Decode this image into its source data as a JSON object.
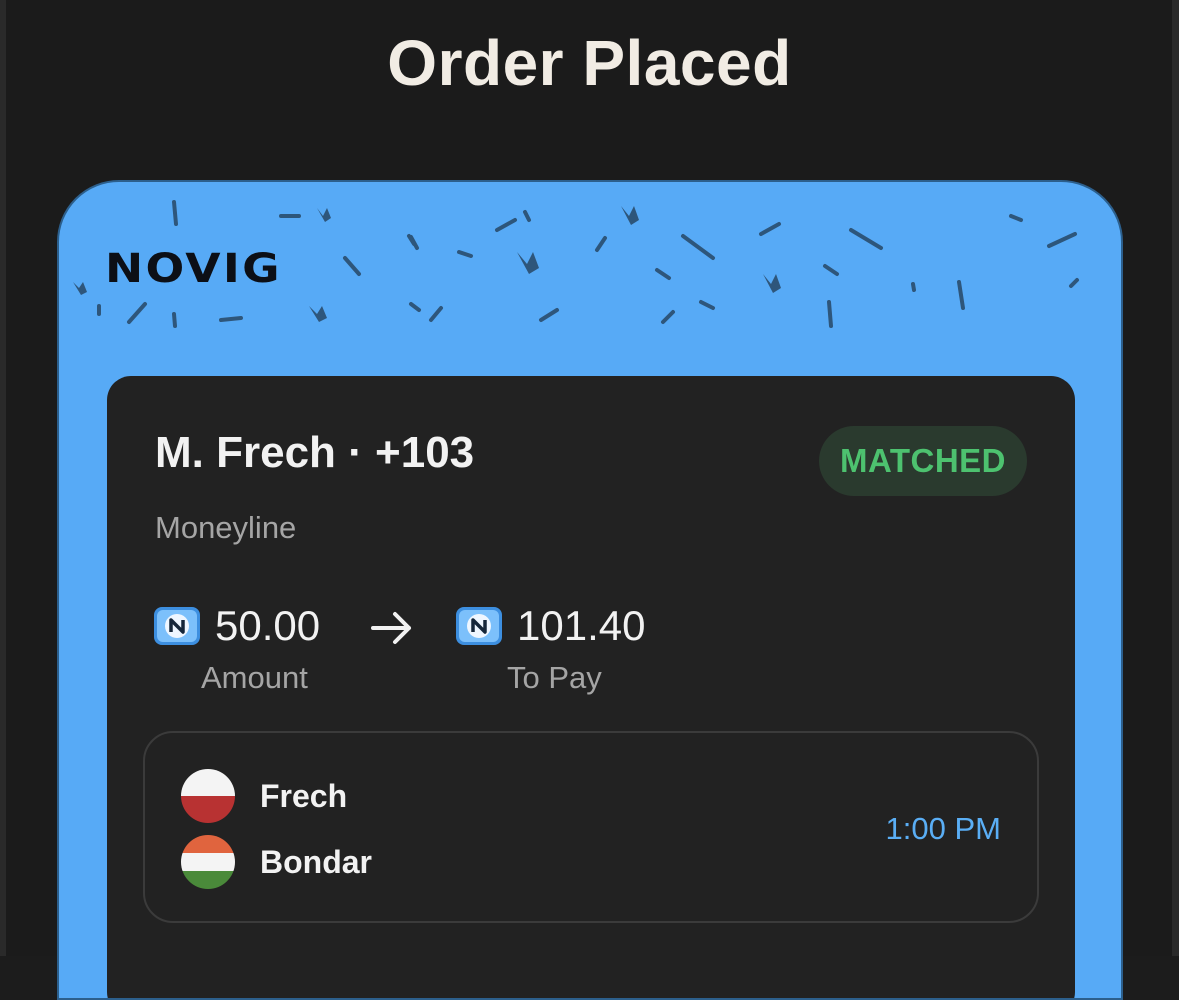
{
  "header": {
    "title": "Order Placed"
  },
  "brand": {
    "logo_text": "NOVIG",
    "accent_color": "#57aaf6"
  },
  "bet": {
    "selection": "M. Frech · +103",
    "status": "MATCHED",
    "status_color": "#4dc26f",
    "market": "Moneyline",
    "amount_value": "50.00",
    "amount_label": "Amount",
    "payout_value": "101.40",
    "payout_label": "To Pay",
    "currency_icon": "novig-coin-icon"
  },
  "matchup": {
    "teams": [
      {
        "name": "Frech",
        "flag": "poland-flag-icon"
      },
      {
        "name": "Bondar",
        "flag": "hungary-flag-icon"
      }
    ],
    "time": "1:00 PM"
  }
}
